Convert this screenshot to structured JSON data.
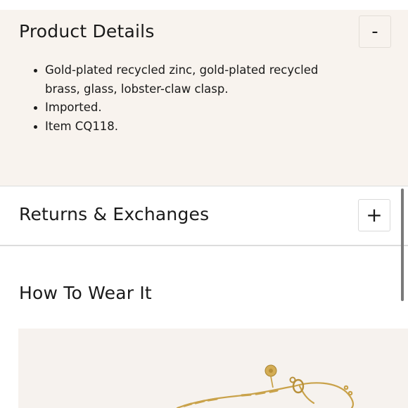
{
  "product_details": {
    "title": "Product Details",
    "toggle_symbol": "-",
    "items": [
      "Gold-plated recycled zinc, gold-plated recycled brass, glass, lobster-claw clasp.",
      "Imported.",
      "Item CQ118."
    ]
  },
  "returns": {
    "title": "Returns & Exchanges",
    "toggle_symbol": "+"
  },
  "how_to_wear": {
    "title": "How To Wear It"
  },
  "colors": {
    "panel_background": "#f8f3ee",
    "divider": "#dcdcdc",
    "text": "#1a1a1a",
    "chain_gold": "#c9a24a"
  }
}
